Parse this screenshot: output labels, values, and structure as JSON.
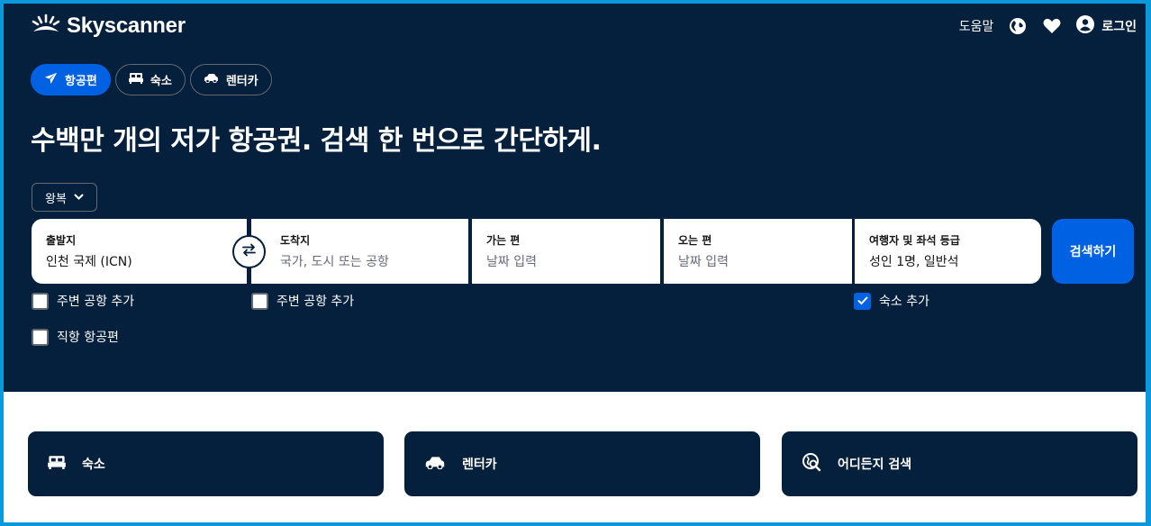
{
  "header": {
    "brand": "Skyscanner",
    "help_label": "도움말",
    "login_label": "로그인",
    "icons": [
      "sunrise-logo-icon",
      "globe-icon",
      "heart-icon",
      "account-icon"
    ]
  },
  "tabs": [
    {
      "label": "항공편",
      "icon": "plane-icon",
      "active": true
    },
    {
      "label": "숙소",
      "icon": "bed-icon",
      "active": false
    },
    {
      "label": "렌터카",
      "icon": "car-icon",
      "active": false
    }
  ],
  "headline": "수백만 개의 저가 항공권. 검색 한 번으로 간단하게.",
  "trip_type": "왕복",
  "search": {
    "origin": {
      "label": "출발지",
      "value": "인천 국제 (ICN)"
    },
    "destination": {
      "label": "도착지",
      "placeholder": "국가, 도시 또는 공항"
    },
    "depart": {
      "label": "가는 편",
      "placeholder": "날짜 입력"
    },
    "return": {
      "label": "오는 편",
      "placeholder": "날짜 입력"
    },
    "travellers": {
      "label": "여행자 및 좌석 등급",
      "value": "성인 1명, 일반석"
    },
    "button_label": "검색하기"
  },
  "options": {
    "nearby_origin": {
      "label": "주변 공항 추가",
      "checked": false
    },
    "nearby_dest": {
      "label": "주변 공항 추가",
      "checked": false
    },
    "direct": {
      "label": "직항 항공편",
      "checked": false
    },
    "add_hotel": {
      "label": "숙소 추가",
      "checked": true
    }
  },
  "cards": [
    {
      "label": "숙소",
      "icon": "bed-icon"
    },
    {
      "label": "렌터카",
      "icon": "car-icon"
    },
    {
      "label": "어디든지 검색",
      "icon": "explore-globe-icon"
    }
  ],
  "colors": {
    "navy": "#05203c",
    "primary_blue": "#0062e3",
    "frame_blue": "#0b99dc",
    "white": "#ffffff"
  }
}
